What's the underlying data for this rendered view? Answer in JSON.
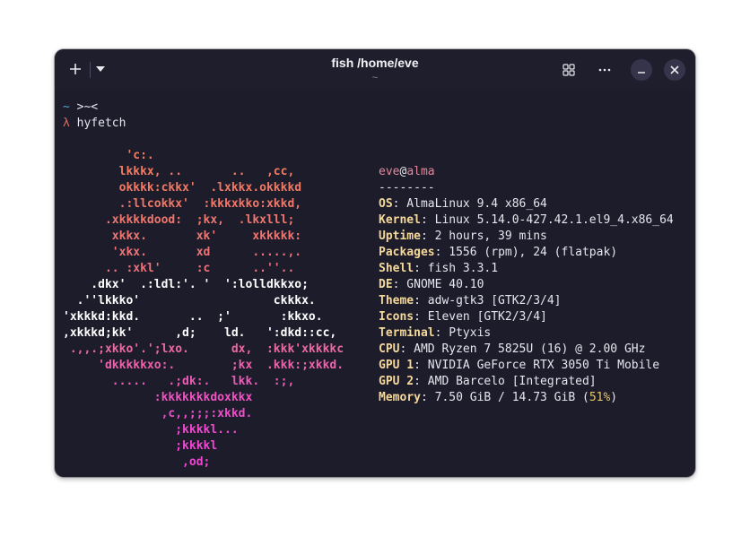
{
  "window": {
    "title": "fish /home/eve",
    "subtitle": "~"
  },
  "icons": {
    "new_tab": "plus-icon",
    "tab_menu": "chevron-down-icon",
    "overview": "grid-icon",
    "menu": "more-horizontal-icon",
    "minimize": "minimize-icon",
    "close": "close-icon"
  },
  "prompt": {
    "line1_symbol": "~",
    "line1_text": " >~<",
    "line2_symbol": "λ",
    "line2_command": " hyfetch"
  },
  "ascii_art": [
    {
      "text": "         'c:.",
      "color": "#f07d63"
    },
    {
      "text": "        lkkkx, ..       ..   ,cc,",
      "color": "#f07d63"
    },
    {
      "text": "        okkkk:ckkx'  .lxkkx.okkkkd",
      "color": "#f07a64"
    },
    {
      "text": "        .:llcokkx'  :kkkxkko:xkkd,",
      "color": "#f07868"
    },
    {
      "text": "      .xkkkkdood:  ;kx,  .lkxlll;",
      "color": "#f0776c"
    },
    {
      "text": "       xkkx.       xk'     xkkkkk:",
      "color": "#f07570"
    },
    {
      "text": "       'xkx.       xd      .....,.",
      "color": "#f07274"
    },
    {
      "text": "      .. :xkl'     :c      ..''..",
      "color": "#ef7078"
    },
    {
      "text": "    .dkx'  .:ldl:'. '  ':lolldkkxo;",
      "color": "#ffffff"
    },
    {
      "text": "  .''lkkko'                   ckkkx.",
      "color": "#ffffff"
    },
    {
      "text": "'xkkkd:kkd.       ..  ;'       :kkxo.",
      "color": "#ffffff"
    },
    {
      "text": ",xkkkd;kk'      ,d;    ld.   ':dkd::cc,",
      "color": "#ffffff"
    },
    {
      "text": " .,,.;xkko'.';lxo.      dx,  :kkk'xkkkkc",
      "color": "#ec6aa2"
    },
    {
      "text": "     'dkkkkkxo:.        ;kx  .kkk:;xkkd.",
      "color": "#ec62ac"
    },
    {
      "text": "       .....   .;dk:.   lkk.  :;,",
      "color": "#ec5cb6"
    },
    {
      "text": "             :kkkkkkkdoxkkx",
      "color": "#ec54c0"
    },
    {
      "text": "              ,c,,;;;:xkkd.",
      "color": "#ee4ec8"
    },
    {
      "text": "                ;kkkkl...",
      "color": "#f048cf"
    },
    {
      "text": "                ;kkkkl",
      "color": "#f046d2"
    },
    {
      "text": "                 ,od;",
      "color": "#f046d4"
    }
  ],
  "sysinfo": {
    "user": "eve",
    "at": "@",
    "host": "alma",
    "separator": "--------",
    "rows": [
      {
        "key": "OS",
        "value": ": AlmaLinux 9.4 x86_64"
      },
      {
        "key": "Kernel",
        "value": ": Linux 5.14.0-427.42.1.el9_4.x86_64"
      },
      {
        "key": "Uptime",
        "value": ": 2 hours, 39 mins"
      },
      {
        "key": "Packages",
        "value": ": 1556 (rpm), 24 (flatpak)"
      },
      {
        "key": "Shell",
        "value": ": fish 3.3.1"
      },
      {
        "key": "DE",
        "value": ": GNOME 40.10"
      },
      {
        "key": "Theme",
        "value": ": adw-gtk3 [GTK2/3/4]"
      },
      {
        "key": "Icons",
        "value": ": Eleven [GTK2/3/4]"
      },
      {
        "key": "Terminal",
        "value": ": Ptyxis"
      },
      {
        "key": "CPU",
        "value": ": AMD Ryzen 7 5825U (16) @ 2.00 GHz"
      },
      {
        "key": "GPU 1",
        "value": ": NVIDIA GeForce RTX 3050 Ti Mobile"
      },
      {
        "key": "GPU 2",
        "value": ": AMD Barcelo [Integrated]"
      },
      {
        "key": "Memory",
        "value": ": 7.50 GiB / 14.73 GiB (",
        "percent": "51%",
        "tail": ")"
      }
    ]
  },
  "colors": {
    "background": "#1d1c2b",
    "key": "#f5d99a",
    "user": "#e2889c",
    "memory_percent": "#e8c76a",
    "prompt_tilde": "#5ba3d0",
    "prompt_lambda": "#e06b5f"
  }
}
